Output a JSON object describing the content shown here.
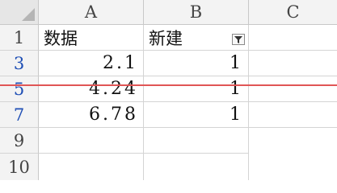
{
  "columns": [
    "A",
    "B",
    "C"
  ],
  "rows": [
    {
      "row": "1",
      "a": "数据",
      "b": "新建",
      "filtered": false
    },
    {
      "row": "3",
      "a": "2.1",
      "b": "1",
      "filtered": true
    },
    {
      "row": "5",
      "a": "4.24",
      "b": "1",
      "filtered": true
    },
    {
      "row": "7",
      "a": "6.78",
      "b": "1",
      "filtered": true
    },
    {
      "row": "9",
      "a": "",
      "b": "",
      "filtered": false
    },
    {
      "row": "10",
      "a": "",
      "b": "",
      "filtered": false
    }
  ],
  "filter_icon": "filter-funnel-icon",
  "colors": {
    "filtered_row_number": "#1f4fb5",
    "highlight_line": "#e05555"
  }
}
